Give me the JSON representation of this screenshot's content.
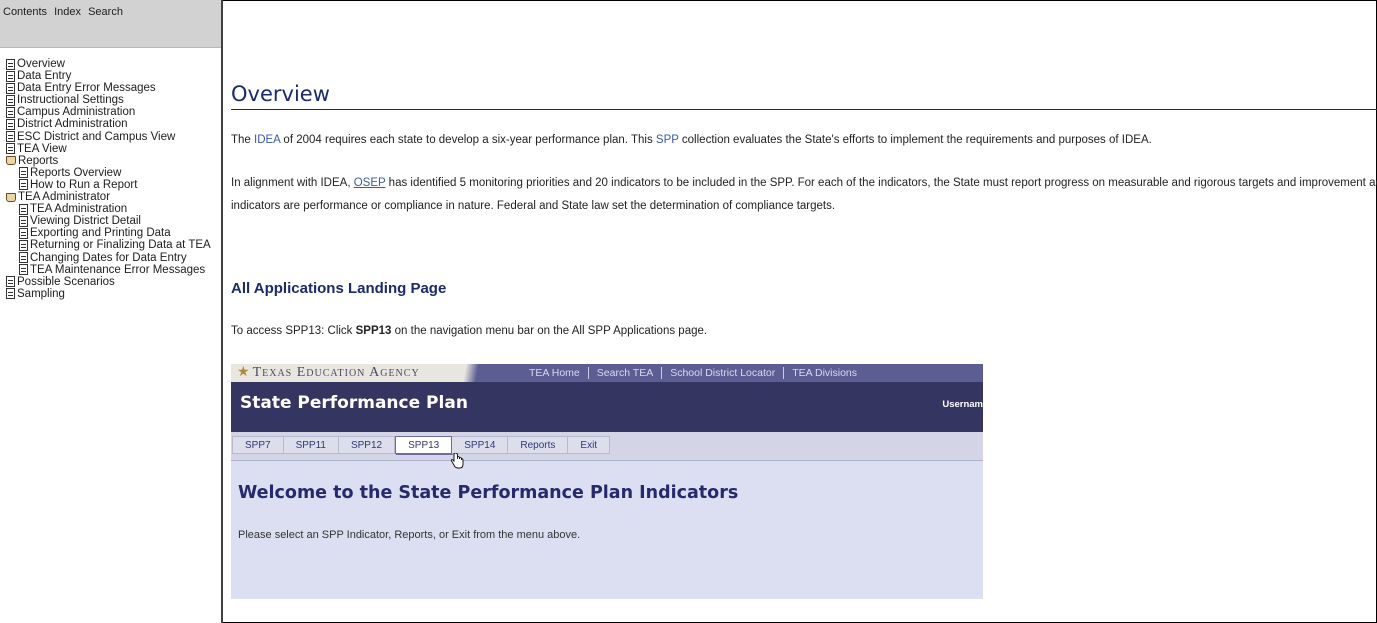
{
  "left_nav": {
    "tabs": [
      "Contents",
      "Index",
      "Search"
    ],
    "items": [
      {
        "label": "Overview",
        "icon": "page-icon",
        "level": 1
      },
      {
        "label": "Data Entry",
        "icon": "page-icon",
        "level": 1
      },
      {
        "label": "Data Entry Error Messages",
        "icon": "page-icon",
        "level": 1
      },
      {
        "label": "Instructional Settings",
        "icon": "page-icon",
        "level": 1
      },
      {
        "label": "Campus Administration",
        "icon": "page-icon",
        "level": 1
      },
      {
        "label": "District Administration",
        "icon": "page-icon",
        "level": 1
      },
      {
        "label": "ESC District and Campus View",
        "icon": "page-icon",
        "level": 1
      },
      {
        "label": "TEA View",
        "icon": "page-icon",
        "level": 1
      },
      {
        "label": "Reports",
        "icon": "book-icon",
        "level": 1
      },
      {
        "label": "Reports Overview",
        "icon": "page-icon",
        "level": 2
      },
      {
        "label": "How to Run a Report",
        "icon": "page-icon",
        "level": 2
      },
      {
        "label": "TEA Administrator",
        "icon": "book-icon",
        "level": 1
      },
      {
        "label": "TEA Administration",
        "icon": "page-icon",
        "level": 2
      },
      {
        "label": "Viewing District Detail",
        "icon": "page-icon",
        "level": 2
      },
      {
        "label": "Exporting and Printing Data",
        "icon": "page-icon",
        "level": 2
      },
      {
        "label": "Returning or Finalizing Data at TEA",
        "icon": "page-icon",
        "level": 2
      },
      {
        "label": "Changing Dates for Data Entry",
        "icon": "page-icon",
        "level": 2
      },
      {
        "label": "TEA Maintenance Error Messages",
        "icon": "page-icon",
        "level": 2
      },
      {
        "label": "Possible Scenarios",
        "icon": "page-icon",
        "level": 1
      },
      {
        "label": "Sampling",
        "icon": "page-icon",
        "level": 1
      }
    ]
  },
  "main": {
    "title": "Overview",
    "para1": {
      "t1": "The ",
      "link1": "IDEA",
      "t2": " of 2004 requires each state to develop a six-year performance plan. This ",
      "link2": "SPP",
      "t3": " collection evaluates the State's efforts to implement the requirements and purposes of IDEA."
    },
    "para2": {
      "t1": "In alignment with IDEA, ",
      "link1": "OSEP",
      "t2": " has identified 5 monitoring priorities and 20 indicators to be included in the SPP. For each of the indicators, the State must report progress on measurable and rigorous targets and improvement activities",
      "line2": "indicators are performance or compliance in nature. Federal and State law set the determination of compliance targets."
    },
    "section_heading": "All Applications Landing Page",
    "para3": {
      "t1": "To access SPP13: Click ",
      "bold": "SPP13",
      "t2": " on the navigation menu bar on the All SPP Applications page."
    }
  },
  "screenshot": {
    "agency_name": "Texas Education Agency",
    "top_links": [
      "TEA Home",
      "Search TEA",
      "School District Locator",
      "TEA Divisions"
    ],
    "app_title": "State Performance Plan",
    "username_label": "Usernam",
    "menu": [
      "SPP7",
      "SPP11",
      "SPP12",
      "SPP13",
      "SPP14",
      "Reports",
      "Exit"
    ],
    "active_menu": "SPP13",
    "welcome": "Welcome to the State Performance Plan Indicators",
    "instruction": "Please select an SPP Indicator, Reports, or Exit from the menu above."
  },
  "colors": {
    "heading": "#1b2a6b",
    "link": "#3a5aa8",
    "app_header": "#343561",
    "app_topbar": "#5c5d93",
    "app_body": "#dcdff1"
  }
}
